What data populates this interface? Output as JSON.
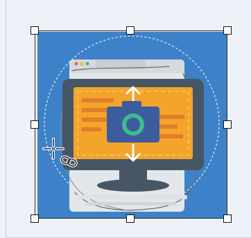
{
  "canvas": {
    "background_color": "#eef2f8"
  },
  "image": {
    "subject": "computer-monitor-with-camera-illustration",
    "colors": {
      "background": "#3d82c8",
      "circle_outline": "#dce8f4",
      "browser_frame": "#e4e7ea",
      "dot_red": "#e56a4a",
      "dot_yellow": "#f2b93b",
      "dot_green": "#4cb5a0",
      "monitor_bezel": "#465664",
      "screen": "#f3a42a",
      "screen_lines": "#e07e2a",
      "camera_body": "#3d5c9e",
      "camera_lens_ring": "#3dbb8c",
      "arrows": "#ffffff",
      "stand": "#465664",
      "keyboard": "#dfe2e5"
    }
  },
  "selection": {
    "handles": [
      "top-left",
      "top-center",
      "top-right",
      "middle-left",
      "middle-right",
      "bottom-left",
      "bottom-center",
      "bottom-right"
    ],
    "border_color": "#2a2a2a"
  },
  "tools": {
    "cursor": "move-crosshair-icon",
    "link": "chain-link-icon"
  }
}
